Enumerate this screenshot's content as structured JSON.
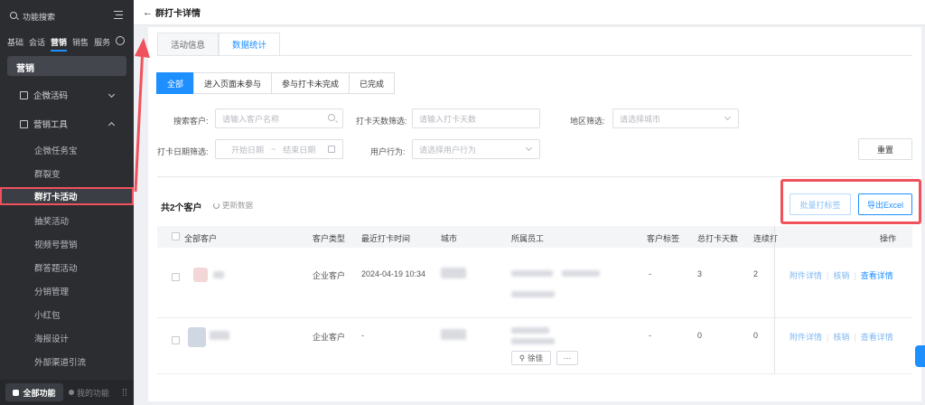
{
  "sidebar": {
    "search_label": "功能搜索",
    "categories": [
      "基础",
      "会话",
      "营销",
      "销售",
      "服务"
    ],
    "section_title": "营销",
    "groups": [
      {
        "label": "企微活码",
        "expanded": false
      },
      {
        "label": "营销工具",
        "expanded": true
      }
    ],
    "items": [
      "企微任务宝",
      "群裂变",
      "群打卡活动",
      "抽奖活动",
      "视频号营销",
      "群答题活动",
      "分销管理",
      "小红包",
      "海报设计",
      "外部渠道引流"
    ],
    "active_item": "群打卡活动",
    "bottom_all": "全部功能",
    "bottom_mine": "我的功能"
  },
  "header": {
    "title": "群打卡详情"
  },
  "tabs": [
    "活动信息",
    "数据统计"
  ],
  "active_tab": "数据统计",
  "segments": [
    "全部",
    "进入页面未参与",
    "参与打卡未完成",
    "已完成"
  ],
  "active_segment": "全部",
  "filters": {
    "search_customer": {
      "label": "搜索客户:",
      "placeholder": "请输入客户名称"
    },
    "checkin_days": {
      "label": "打卡天数筛选:",
      "placeholder": "请输入打卡天数"
    },
    "region": {
      "label": "地区筛选:",
      "placeholder": "请选择城市"
    },
    "date": {
      "label": "打卡日期筛选:",
      "start": "开始日期",
      "sep": "~",
      "end": "结束日期"
    },
    "behavior": {
      "label": "用户行为:",
      "placeholder": "请选择用户行为"
    },
    "reset_label": "重置"
  },
  "summary": {
    "count_text": "共2个客户",
    "refresh_label": "更新数据"
  },
  "actions": {
    "batch_tag": "批量打标签",
    "export": "导出Excel"
  },
  "table": {
    "columns": [
      "全部客户",
      "客户类型",
      "最近打卡时间",
      "城市",
      "所属员工",
      "客户标签",
      "总打卡天数",
      "连续打",
      "操作"
    ],
    "rows": [
      {
        "type": "企业客户",
        "last_time": "2024-04-19 10:34",
        "tag": "-",
        "total_days": "3",
        "streak": "2",
        "ops": [
          "附件详情",
          "核销",
          "查看详情"
        ],
        "staff_button": ""
      },
      {
        "type": "企业客户",
        "last_time": "-",
        "tag": "-",
        "total_days": "0",
        "streak": "0",
        "ops": [
          "附件详情",
          "核销",
          "查看详情"
        ],
        "staff_button": "徐佳"
      }
    ]
  },
  "more_button": "···",
  "colors": {
    "accent": "#1e8fff",
    "highlight": "#f0525d",
    "sidebar_bg": "#2b2d31"
  }
}
